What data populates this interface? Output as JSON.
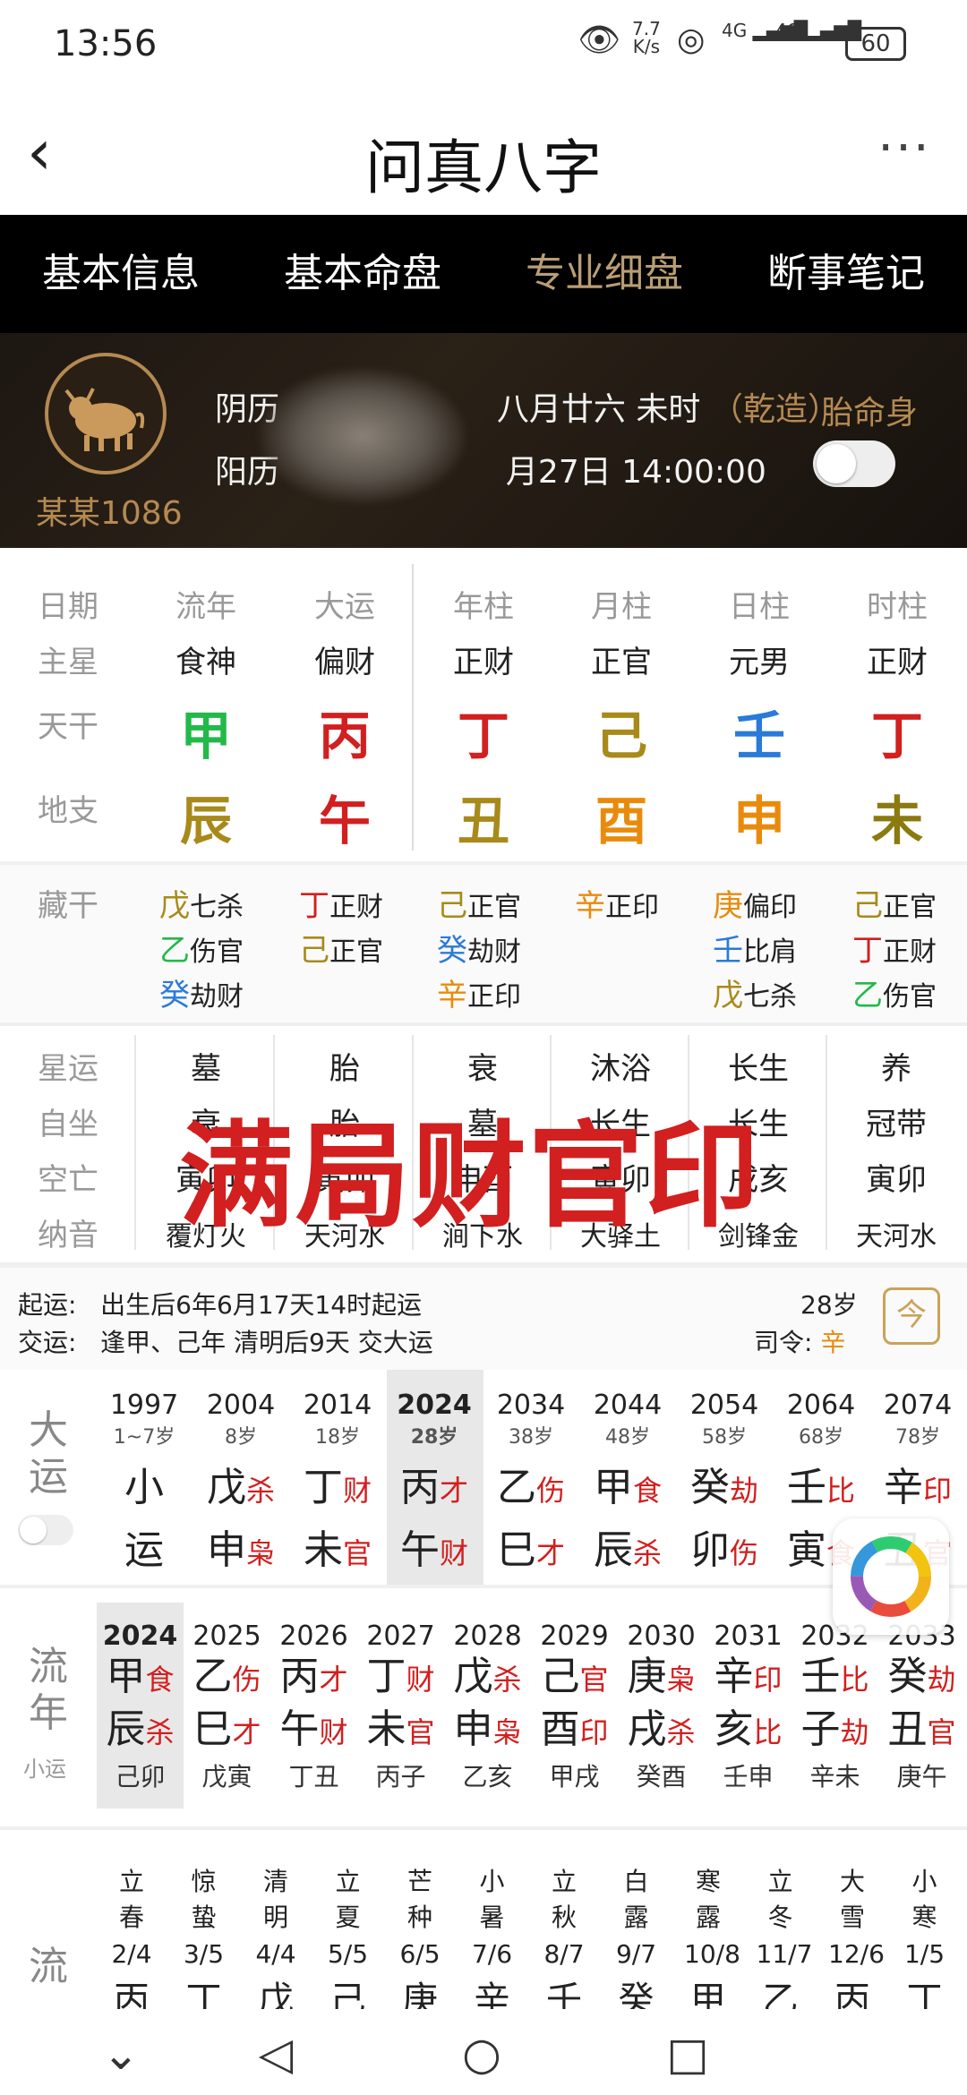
{
  "status": {
    "time": "13:56",
    "speed_top": "7.7",
    "speed_bot": "K/s",
    "net1": "4G",
    "net2": "4G",
    "battery": "60"
  },
  "title": "问真八字",
  "tabs": [
    "基本信息",
    "基本命盘",
    "专业细盘",
    "断事笔记"
  ],
  "profile": {
    "name": "某某1086",
    "lunar_label": "阴历",
    "lunar_tail": "八月廿六 未时",
    "gender_tag": "（乾造）",
    "solar_label": "阳历",
    "solar_tail": "月27日 14:00:00",
    "toggle_label": "胎命身"
  },
  "pillars": {
    "labels": {
      "date": "日期",
      "main_star": "主星",
      "tiangan": "天干",
      "dizhi": "地支"
    },
    "headers": [
      "流年",
      "大运",
      "年柱",
      "月柱",
      "日柱",
      "时柱"
    ],
    "main_stars": [
      "食神",
      "偏财",
      "正财",
      "正官",
      "元男",
      "正财"
    ],
    "tiangan": [
      "甲",
      "丙",
      "丁",
      "己",
      "壬",
      "丁"
    ],
    "dizhi": [
      "辰",
      "午",
      "丑",
      "酉",
      "申",
      "未"
    ],
    "colors": {
      "green": "#22b94a",
      "red": "#d21f1f",
      "gold": "#a88a1a",
      "blue": "#2a7ad8",
      "orange": "#e88b0c"
    }
  },
  "canggan": {
    "label": "藏干",
    "cols": [
      [
        [
          "戊",
          "七杀"
        ],
        [
          "乙",
          "伤官"
        ],
        [
          "癸",
          "劫财"
        ]
      ],
      [
        [
          "丁",
          "正财"
        ],
        [
          "己",
          "正官"
        ]
      ],
      [
        [
          "己",
          "正官"
        ],
        [
          "癸",
          "劫财"
        ],
        [
          "辛",
          "正印"
        ]
      ],
      [
        [
          "辛",
          "正印"
        ]
      ],
      [
        [
          "庚",
          "偏印"
        ],
        [
          "壬",
          "比肩"
        ],
        [
          "戊",
          "七杀"
        ]
      ],
      [
        [
          "己",
          "正官"
        ],
        [
          "丁",
          "正财"
        ],
        [
          "乙",
          "伤官"
        ]
      ]
    ]
  },
  "xingyun": {
    "labels": [
      "星运",
      "自坐",
      "空亡",
      "纳音"
    ],
    "xingyun": [
      "墓",
      "胎",
      "衰",
      "沐浴",
      "长生",
      "养"
    ],
    "zizuo": [
      "衰",
      "胎",
      "墓",
      "长生",
      "长生",
      "冠带"
    ],
    "kongwang": [
      "寅卯",
      "寅卯",
      "申酉",
      "寅卯",
      "戌亥",
      "寅卯"
    ],
    "nayin": [
      "覆灯火",
      "天河水",
      "涧下水",
      "大驿土",
      "剑锋金",
      "天河水"
    ],
    "stamp": "满局财官印"
  },
  "qiyun": {
    "label1": "起运:",
    "text1": "出生后6年6月17天14时起运",
    "label2": "交运:",
    "text2": "逢甲、己年 清明后9天 交大运",
    "age": "28岁",
    "siling_label": "司令:",
    "siling": "辛",
    "today": "今"
  },
  "dayun": {
    "label": "大运",
    "cols": [
      {
        "year": "1997",
        "age": "1~7岁",
        "g": "小",
        "z": "运",
        "gs": "",
        "zs": ""
      },
      {
        "year": "2004",
        "age": "8岁",
        "g": "戊",
        "gs": "杀",
        "z": "申",
        "zs": "枭"
      },
      {
        "year": "2014",
        "age": "18岁",
        "g": "丁",
        "gs": "财",
        "z": "未",
        "zs": "官"
      },
      {
        "year": "2024",
        "age": "28岁",
        "g": "丙",
        "gs": "才",
        "z": "午",
        "zs": "财"
      },
      {
        "year": "2034",
        "age": "38岁",
        "g": "乙",
        "gs": "伤",
        "z": "巳",
        "zs": "才"
      },
      {
        "year": "2044",
        "age": "48岁",
        "g": "甲",
        "gs": "食",
        "z": "辰",
        "zs": "杀"
      },
      {
        "year": "2054",
        "age": "58岁",
        "g": "癸",
        "gs": "劫",
        "z": "卯",
        "zs": "伤"
      },
      {
        "year": "2064",
        "age": "68岁",
        "g": "壬",
        "gs": "比",
        "z": "寅",
        "zs": "食"
      },
      {
        "year": "2074",
        "age": "78岁",
        "g": "辛",
        "gs": "印",
        "z": "丑",
        "zs": "官"
      }
    ]
  },
  "liunian": {
    "label": "流年",
    "sub": "小运",
    "cols": [
      {
        "year": "2024",
        "g": "甲",
        "gs": "食",
        "z": "辰",
        "zs": "杀",
        "xy": "己卯"
      },
      {
        "year": "2025",
        "g": "乙",
        "gs": "伤",
        "z": "巳",
        "zs": "才",
        "xy": "戊寅"
      },
      {
        "year": "2026",
        "g": "丙",
        "gs": "才",
        "z": "午",
        "zs": "财",
        "xy": "丁丑"
      },
      {
        "year": "2027",
        "g": "丁",
        "gs": "财",
        "z": "未",
        "zs": "官",
        "xy": "丙子"
      },
      {
        "year": "2028",
        "g": "戊",
        "gs": "杀",
        "z": "申",
        "zs": "枭",
        "xy": "乙亥"
      },
      {
        "year": "2029",
        "g": "己",
        "gs": "官",
        "z": "酉",
        "zs": "印",
        "xy": "甲戌"
      },
      {
        "year": "2030",
        "g": "庚",
        "gs": "枭",
        "z": "戌",
        "zs": "杀",
        "xy": "癸酉"
      },
      {
        "year": "2031",
        "g": "辛",
        "gs": "印",
        "z": "亥",
        "zs": "比",
        "xy": "壬申"
      },
      {
        "year": "2032",
        "g": "壬",
        "gs": "比",
        "z": "子",
        "zs": "劫",
        "xy": "辛未"
      },
      {
        "year": "2033",
        "g": "癸",
        "gs": "劫",
        "z": "丑",
        "zs": "官",
        "xy": "庚午"
      }
    ]
  },
  "liuyue": {
    "label": "流",
    "cols": [
      {
        "n": "立春",
        "d": "2/4",
        "g": "丙"
      },
      {
        "n": "惊蛰",
        "d": "3/5",
        "g": "丁"
      },
      {
        "n": "清明",
        "d": "4/4",
        "g": "戊"
      },
      {
        "n": "立夏",
        "d": "5/5",
        "g": "己"
      },
      {
        "n": "芒种",
        "d": "6/5",
        "g": "庚"
      },
      {
        "n": "小暑",
        "d": "7/6",
        "g": "辛"
      },
      {
        "n": "立秋",
        "d": "8/7",
        "g": "壬"
      },
      {
        "n": "白露",
        "d": "9/7",
        "g": "癸"
      },
      {
        "n": "寒露",
        "d": "10/8",
        "g": "甲"
      },
      {
        "n": "立冬",
        "d": "11/7",
        "g": "乙"
      },
      {
        "n": "大雪",
        "d": "12/6",
        "g": "丙"
      },
      {
        "n": "小寒",
        "d": "1/5",
        "g": "丁"
      }
    ]
  }
}
